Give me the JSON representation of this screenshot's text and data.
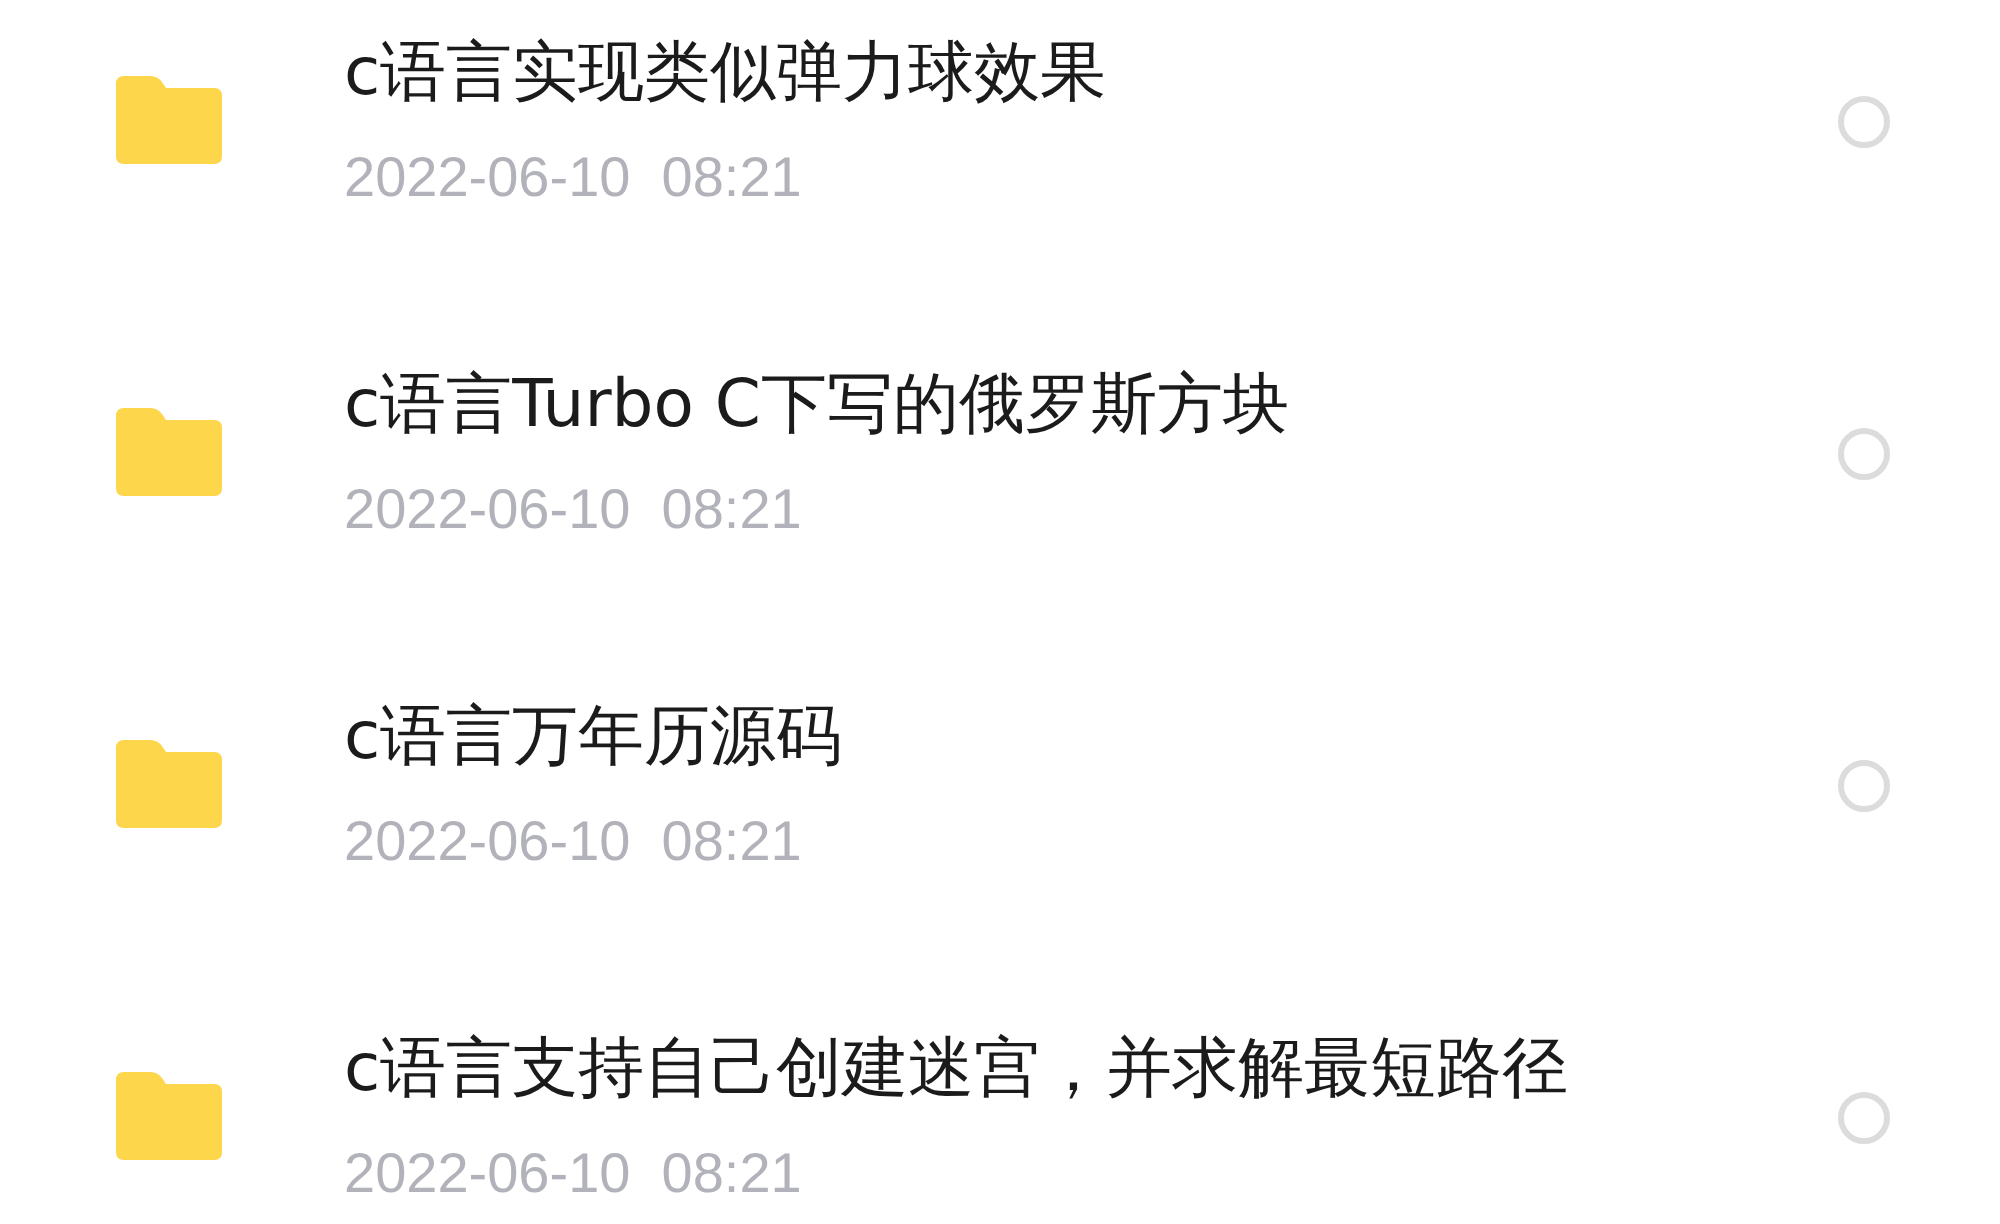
{
  "files": [
    {
      "name": "c语言实现类似弹力球效果",
      "modified": "2022-06-10  08:21",
      "selected": false
    },
    {
      "name": "c语言Turbo C下写的俄罗斯方块",
      "modified": "2022-06-10  08:21",
      "selected": false
    },
    {
      "name": "c语言万年历源码",
      "modified": "2022-06-10  08:21",
      "selected": false
    },
    {
      "name": "c语言支持自己创建迷宫，并求解最短路径",
      "modified": "2022-06-10  08:21",
      "selected": false
    }
  ]
}
